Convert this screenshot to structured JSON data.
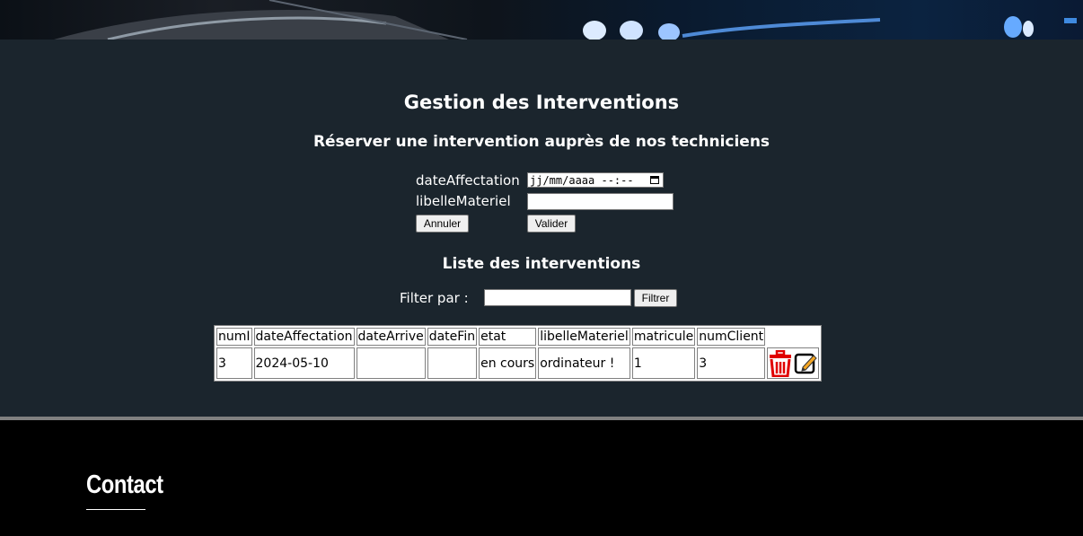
{
  "page": {
    "title": "Gestion des Interventions",
    "subtitle": "Réserver une intervention auprès de nos techniciens"
  },
  "form": {
    "date_label": "dateAffectation",
    "date_placeholder": "jj/mm/aaaa --:--",
    "materiel_label": "libelleMateriel",
    "materiel_value": "",
    "cancel_label": "Annuler",
    "submit_label": "Valider"
  },
  "list": {
    "title": "Liste des interventions",
    "filter_label": "Filter par :",
    "filter_value": "",
    "filter_button": "Filtrer"
  },
  "table": {
    "headers": [
      "numI",
      "dateAffectation",
      "dateArrive",
      "dateFin",
      "etat",
      "libelleMateriel",
      "matricule",
      "numClient",
      ""
    ],
    "rows": [
      [
        "3",
        "2024-05-10",
        "",
        "",
        "en cours",
        "ordinateur !",
        "1",
        "3"
      ]
    ],
    "icons": [
      "trash-icon",
      "edit-icon"
    ]
  },
  "footer": {
    "contact_title": "Contact"
  },
  "colors": {
    "background": "#1b252d",
    "footer": "#000000",
    "trash": "#e00000",
    "edit": "#f5a623"
  }
}
